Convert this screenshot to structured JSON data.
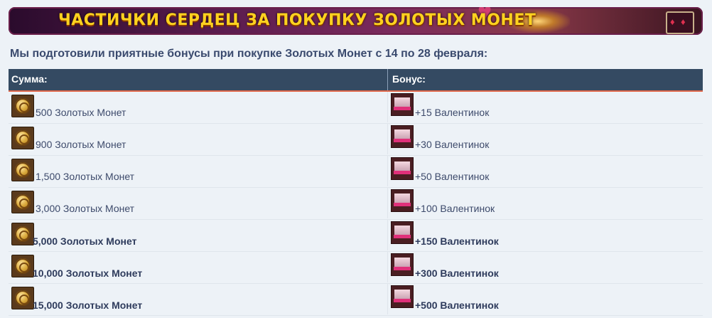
{
  "banner": {
    "title": "ЧАСТИЧКИ СЕРДЕЦ ЗА ПОКУПКУ ЗОЛОТЫХ МОНЕТ",
    "colors": {
      "title": "#ffd21f",
      "background": "#5a1c4e"
    }
  },
  "intro": "Мы подготовили приятные бонусы при покупке Золотых Монет с 14 по 28 февраля:",
  "table": {
    "headers": {
      "amount": "Сумма:",
      "bonus": "Бонус:"
    },
    "header_color": "#344a62",
    "accent_color": "#e0674a",
    "rows": [
      {
        "amount": "500 Золотых Монет",
        "bonus": "+15 Валентинок",
        "bold": false,
        "amount_icon": "gold-coin-icon",
        "bonus_icon": "valentine-box-icon"
      },
      {
        "amount": "900 Золотых Монет",
        "bonus": "+30 Валентинок",
        "bold": false,
        "amount_icon": "gold-coin-icon",
        "bonus_icon": "valentine-box-icon"
      },
      {
        "amount": "1,500 Золотых Монет",
        "bonus": "+50 Валентинок",
        "bold": false,
        "amount_icon": "gold-coin-icon",
        "bonus_icon": "valentine-box-icon"
      },
      {
        "amount": "3,000 Золотых Монет",
        "bonus": "+100 Валентинок",
        "bold": false,
        "amount_icon": "gold-coin-icon",
        "bonus_icon": "valentine-box-icon"
      },
      {
        "amount": "5,000 Золотых Монет",
        "bonus": "+150 Валентинок",
        "bold": true,
        "amount_icon": "gold-coin-icon",
        "bonus_icon": "valentine-box-icon"
      },
      {
        "amount": "10,000 Золотых Монет",
        "bonus": "+300 Валентинок",
        "bold": true,
        "amount_icon": "gold-coin-icon",
        "bonus_icon": "valentine-box-icon"
      },
      {
        "amount": "15,000 Золотых Монет",
        "bonus": "+500 Валентинок",
        "bold": true,
        "amount_icon": "gold-coin-icon",
        "bonus_icon": "valentine-box-icon"
      }
    ]
  }
}
